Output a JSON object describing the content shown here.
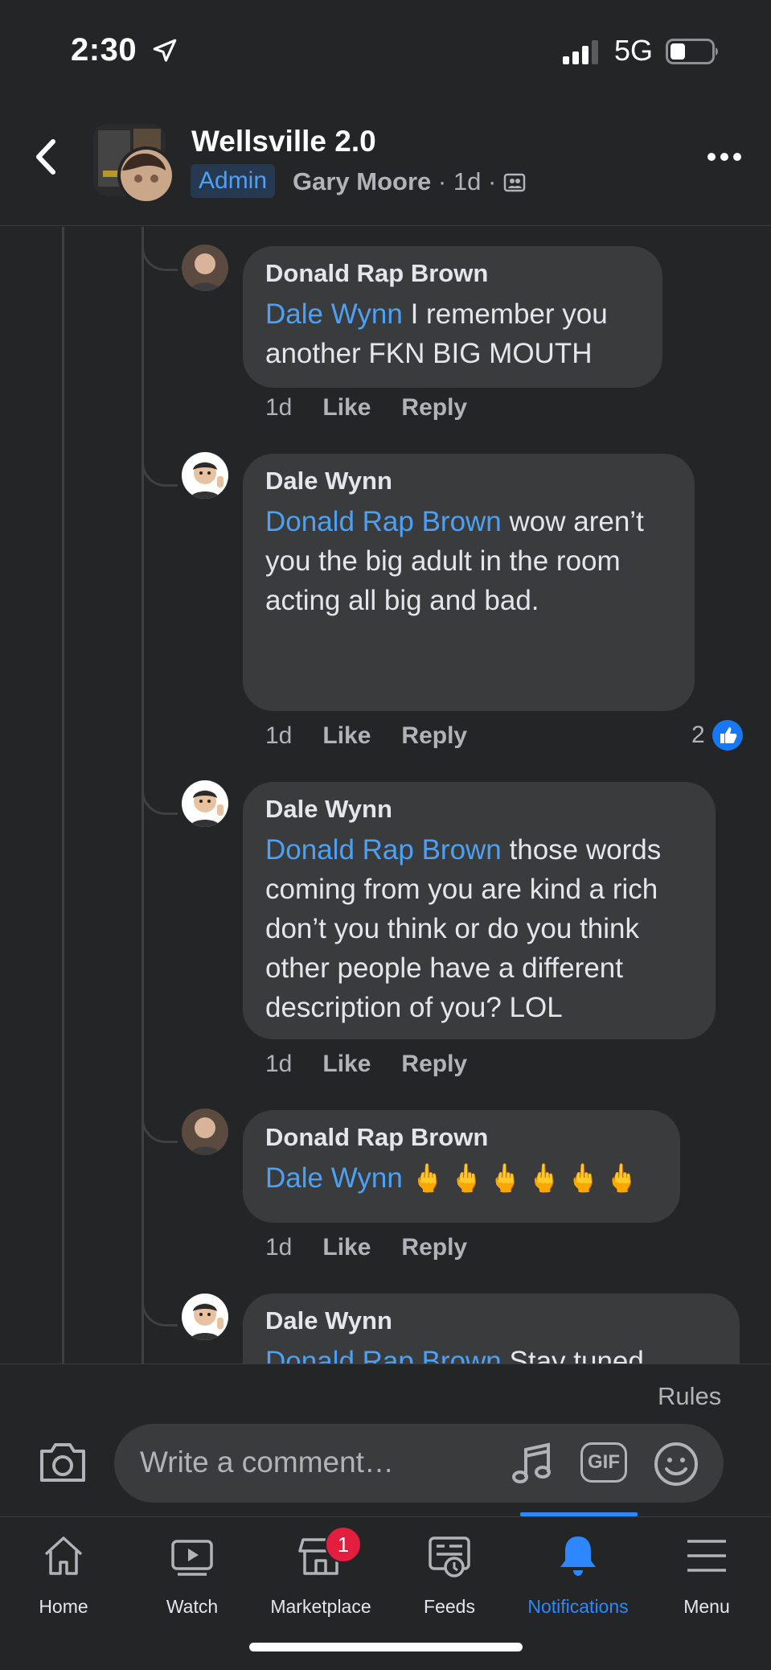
{
  "status_bar": {
    "time": "2:30",
    "network": "5G"
  },
  "header": {
    "title": "Wellsville 2.0",
    "badge": "Admin",
    "author": "Gary Moore",
    "time": "1d"
  },
  "comments": [
    {
      "author": "Donald Rap Brown",
      "mention": "Dale Wynn",
      "text": "  I remember you another FKN BIG MOUTH",
      "time": "1d",
      "like": "Like",
      "reply": "Reply"
    },
    {
      "author": "Dale Wynn",
      "mention": "Donald Rap Brown",
      "text": " wow aren’t you the big adult in the room acting all big and bad.",
      "time": "1d",
      "like": "Like",
      "reply": "Reply",
      "reaction_count": "2"
    },
    {
      "author": "Dale Wynn",
      "mention": "Donald Rap Brown",
      "text": " those words coming from you are kind a rich don’t you think or do you think other people have a different description of you? LOL",
      "time": "1d",
      "like": "Like",
      "reply": "Reply"
    },
    {
      "author": "Donald Rap Brown",
      "mention": "Dale Wynn",
      "emojis": "🖕🖕🖕🖕🖕🖕",
      "time": "1d",
      "like": "Like",
      "reply": "Reply"
    },
    {
      "author": "Dale Wynn",
      "mention": "Donald Rap Brown",
      "text": " Stay tuned"
    }
  ],
  "composer": {
    "rules": "Rules",
    "placeholder": "Write a comment…",
    "gif": "GIF"
  },
  "tabbar": {
    "tabs": [
      {
        "label": "Home",
        "icon": "home-icon"
      },
      {
        "label": "Watch",
        "icon": "watch-icon"
      },
      {
        "label": "Marketplace",
        "icon": "marketplace-icon",
        "badge": "1"
      },
      {
        "label": "Feeds",
        "icon": "feeds-icon"
      },
      {
        "label": "Notifications",
        "icon": "bell-icon",
        "active": true
      },
      {
        "label": "Menu",
        "icon": "menu-icon"
      }
    ]
  },
  "colors": {
    "background": "#242526",
    "bubble": "#3a3b3c",
    "accent": "#2d88ff",
    "mention": "#4da1f5",
    "badge": "#e41e3f"
  }
}
